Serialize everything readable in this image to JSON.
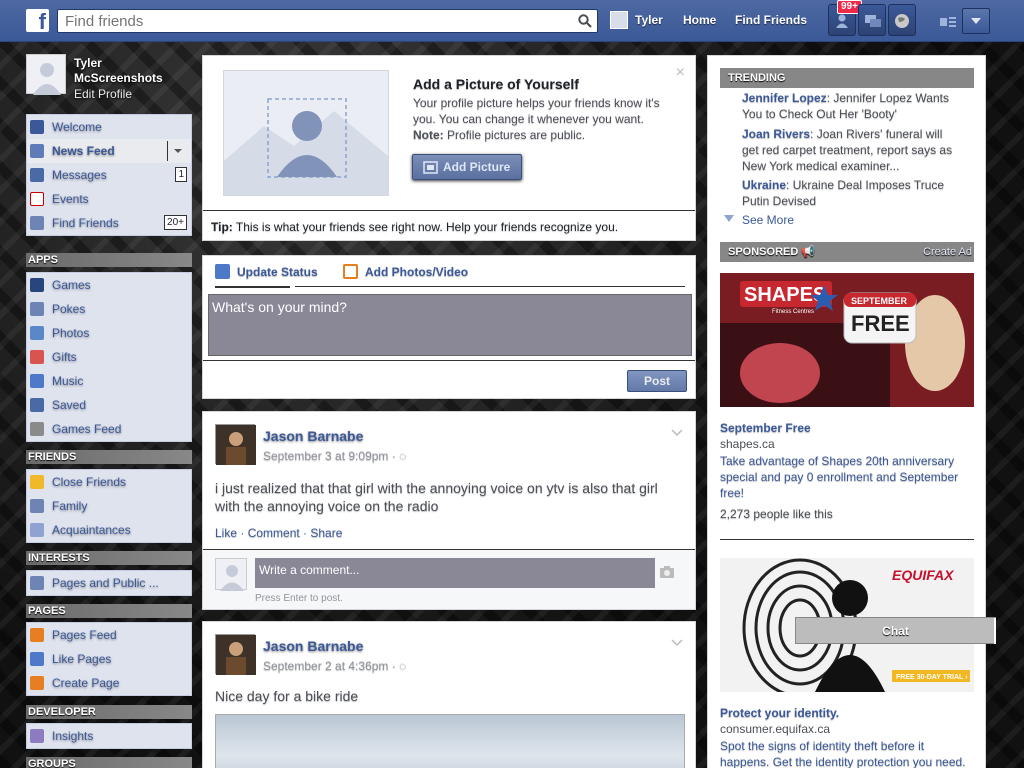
{
  "topbar": {
    "logo": "f",
    "search_placeholder": "Find friends",
    "user_name": "Tyler",
    "home": "Home",
    "find_friends": "Find Friends",
    "notif_badge": "99+",
    "brand_color": "#3b5998"
  },
  "profile": {
    "name": "Tyler McScreenshots",
    "edit": "Edit Profile"
  },
  "favorites": [
    {
      "label": "Welcome",
      "icon": "facebook-icon"
    },
    {
      "label": "News Feed",
      "icon": "news-feed-icon"
    },
    {
      "label": "Messages",
      "icon": "messages-icon",
      "count": "1"
    },
    {
      "label": "Events",
      "icon": "calendar-icon"
    },
    {
      "label": "Find Friends",
      "icon": "friends-icon",
      "count": "20+"
    }
  ],
  "sections": {
    "apps": "APPS",
    "friends": "FRIENDS",
    "interests": "INTERESTS",
    "pages": "PAGES",
    "developer": "DEVELOPER",
    "groups": "GROUPS"
  },
  "apps": [
    {
      "label": "Games",
      "icon": "games-icon"
    },
    {
      "label": "Pokes",
      "icon": "pokes-icon"
    },
    {
      "label": "Photos",
      "icon": "photos-icon"
    },
    {
      "label": "Gifts",
      "icon": "gift-icon"
    },
    {
      "label": "Music",
      "icon": "music-icon"
    },
    {
      "label": "Saved",
      "icon": "bookmark-icon"
    },
    {
      "label": "Games Feed",
      "icon": "gamepad-icon"
    }
  ],
  "friends": [
    {
      "label": "Close Friends",
      "icon": "star-icon"
    },
    {
      "label": "Family",
      "icon": "family-icon"
    },
    {
      "label": "Acquaintances",
      "icon": "acquaintances-icon"
    }
  ],
  "interests": [
    {
      "label": "Pages and Public ...",
      "icon": "rss-icon"
    }
  ],
  "pages": [
    {
      "label": "Pages Feed",
      "icon": "megaphone-icon"
    },
    {
      "label": "Like Pages",
      "icon": "thumbs-up-icon"
    },
    {
      "label": "Create Page",
      "icon": "plus-icon"
    }
  ],
  "developer": [
    {
      "label": "Insights",
      "icon": "insights-icon"
    }
  ],
  "add_picture": {
    "title": "Add a Picture of Yourself",
    "body": "Your profile picture helps your friends know it's you. You can change it whenever you want.",
    "note_label": "Note:",
    "note": "Profile pictures are public.",
    "button": "Add Picture",
    "tip_label": "Tip:",
    "tip": "This is what your friends see right now. Help your friends recognize you."
  },
  "composer": {
    "update_status": "Update Status",
    "add_photos": "Add Photos/Video",
    "placeholder": "What's on your mind?",
    "post": "Post"
  },
  "posts": [
    {
      "author": "Jason Barnabe",
      "time": "September 3 at 9:09pm ·",
      "text": "i just realized that that girl with the annoying voice on ytv is also that girl with the annoying voice on the radio",
      "like": "Like",
      "comment": "Comment",
      "share": "Share",
      "comment_placeholder": "Write a comment...",
      "press_enter": "Press Enter to post."
    },
    {
      "author": "Jason Barnabe",
      "time": "September 2 at 4:36pm ·",
      "text": "Nice day for a bike ride"
    }
  ],
  "trending": {
    "header": "TRENDING",
    "items": [
      {
        "topic": "Jennifer Lopez",
        "text": ": Jennifer Lopez Wants You to Check Out Her 'Booty'"
      },
      {
        "topic": "Joan Rivers",
        "text": ": Joan Rivers' funeral will get red carpet treatment, report says as New York medical examiner..."
      },
      {
        "topic": "Ukraine",
        "text": ": Ukraine Deal Imposes Truce Putin Devised"
      }
    ],
    "see_more": "See More"
  },
  "sponsored": {
    "header": "SPONSORED",
    "create_ad": "Create Ad",
    "ads": [
      {
        "image_text": {
          "brand": "SHAPES",
          "brand_sub": "Fitness Centres",
          "month": "SEPTEMBER",
          "offer": "FREE"
        },
        "title": "September Free",
        "domain": "shapes.ca",
        "body": "Take advantage of Shapes 20th anniversary special and pay 0 enrollment and September free!",
        "likes": "2,273 people like this"
      },
      {
        "image_text": {
          "brand": "EQUIFAX",
          "trial": "FREE 30-DAY TRIAL ›"
        },
        "title": "Protect your identity.",
        "domain": "consumer.equifax.ca",
        "body": "Spot the signs of identity theft before it happens. Get the identity protection you need."
      }
    ]
  },
  "chat": {
    "label": "Chat"
  }
}
